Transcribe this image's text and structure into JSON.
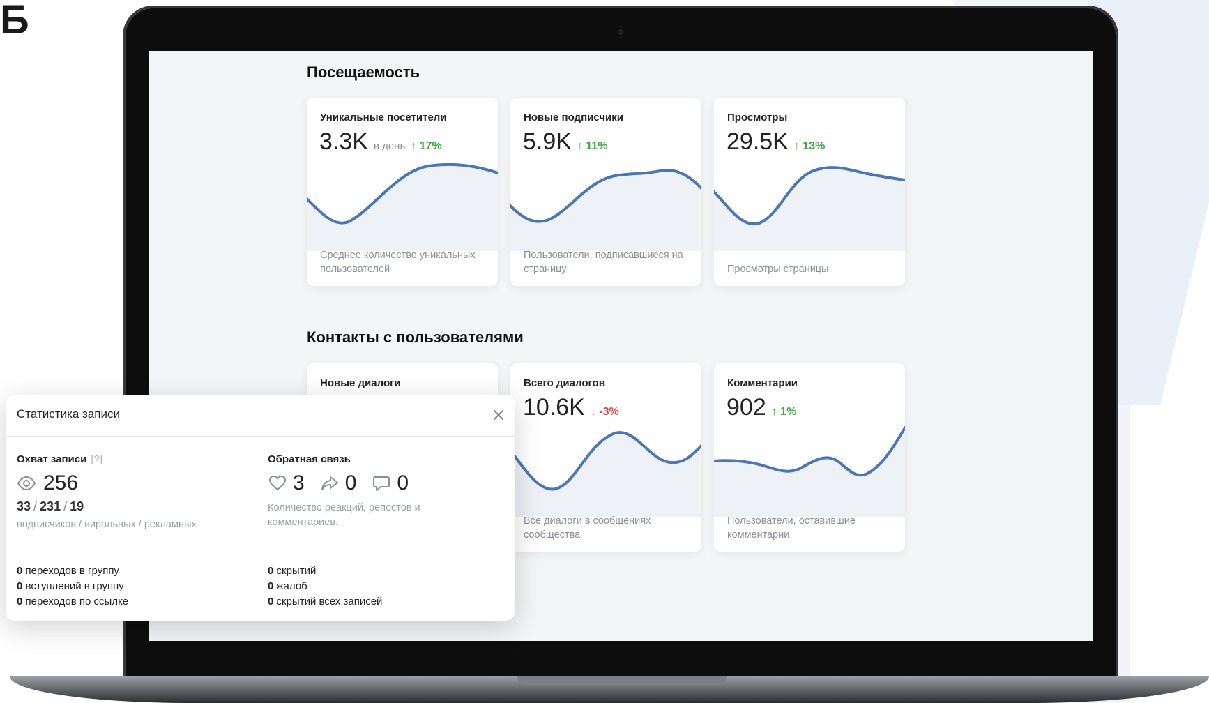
{
  "colors": {
    "accent_line": "#4a76b4",
    "area_fill": "#eef1f6",
    "up": "#3caa3c",
    "down": "#e04444"
  },
  "corner_glyph": "Б",
  "sections": {
    "attendance_title": "Посещаемость",
    "contacts_title": "Контакты с пользователями"
  },
  "cards": [
    {
      "title": "Уникальные посетители",
      "value": "3.3K",
      "unit": "в день",
      "delta": "↑ 17%",
      "trend": "up",
      "desc": "Среднее количество уникальных пользователей"
    },
    {
      "title": "Новые подписчики",
      "value": "5.9K",
      "unit": "",
      "delta": "↑ 11%",
      "trend": "up",
      "desc": "Пользователи, подписавшиеся на страницу"
    },
    {
      "title": "Просмотры",
      "value": "29.5K",
      "unit": "",
      "delta": "↑ 13%",
      "trend": "up",
      "desc": "Просмотры страницы"
    },
    {
      "title": "Новые диалоги",
      "value": "",
      "unit": "",
      "delta": "",
      "trend": "up",
      "desc": ""
    },
    {
      "title": "Всего диалогов",
      "value": "10.6K",
      "unit": "",
      "delta": "↓ -3%",
      "trend": "down",
      "desc": "Все диалоги в сообщениях сообщества"
    },
    {
      "title": "Комментарии",
      "value": "902",
      "unit": "",
      "delta": "↑ 1%",
      "trend": "up",
      "desc": "Пользователи, оставившие комментарии"
    }
  ],
  "popup": {
    "title": "Статистика записи",
    "reach_title": "Охват записи",
    "reach_hint": "[?]",
    "reach_value": "256",
    "split_a": "33",
    "split_b": "231",
    "split_c": "19",
    "split_caption": "подписчиков / виральных / рекламных",
    "feedback_title": "Обратная связь",
    "likes": "3",
    "shares": "0",
    "comments": "0",
    "feedback_caption": "Количество реакций, репостов и комментариев.",
    "left_stats": [
      {
        "num": "0",
        "label": "переходов в группу"
      },
      {
        "num": "0",
        "label": "вступлений в группу"
      },
      {
        "num": "0",
        "label": "переходов по ссылке"
      }
    ],
    "right_stats": [
      {
        "num": "0",
        "label": "скрытий"
      },
      {
        "num": "0",
        "label": "жалоб"
      },
      {
        "num": "0",
        "label": "скрытий всех записей"
      }
    ]
  }
}
